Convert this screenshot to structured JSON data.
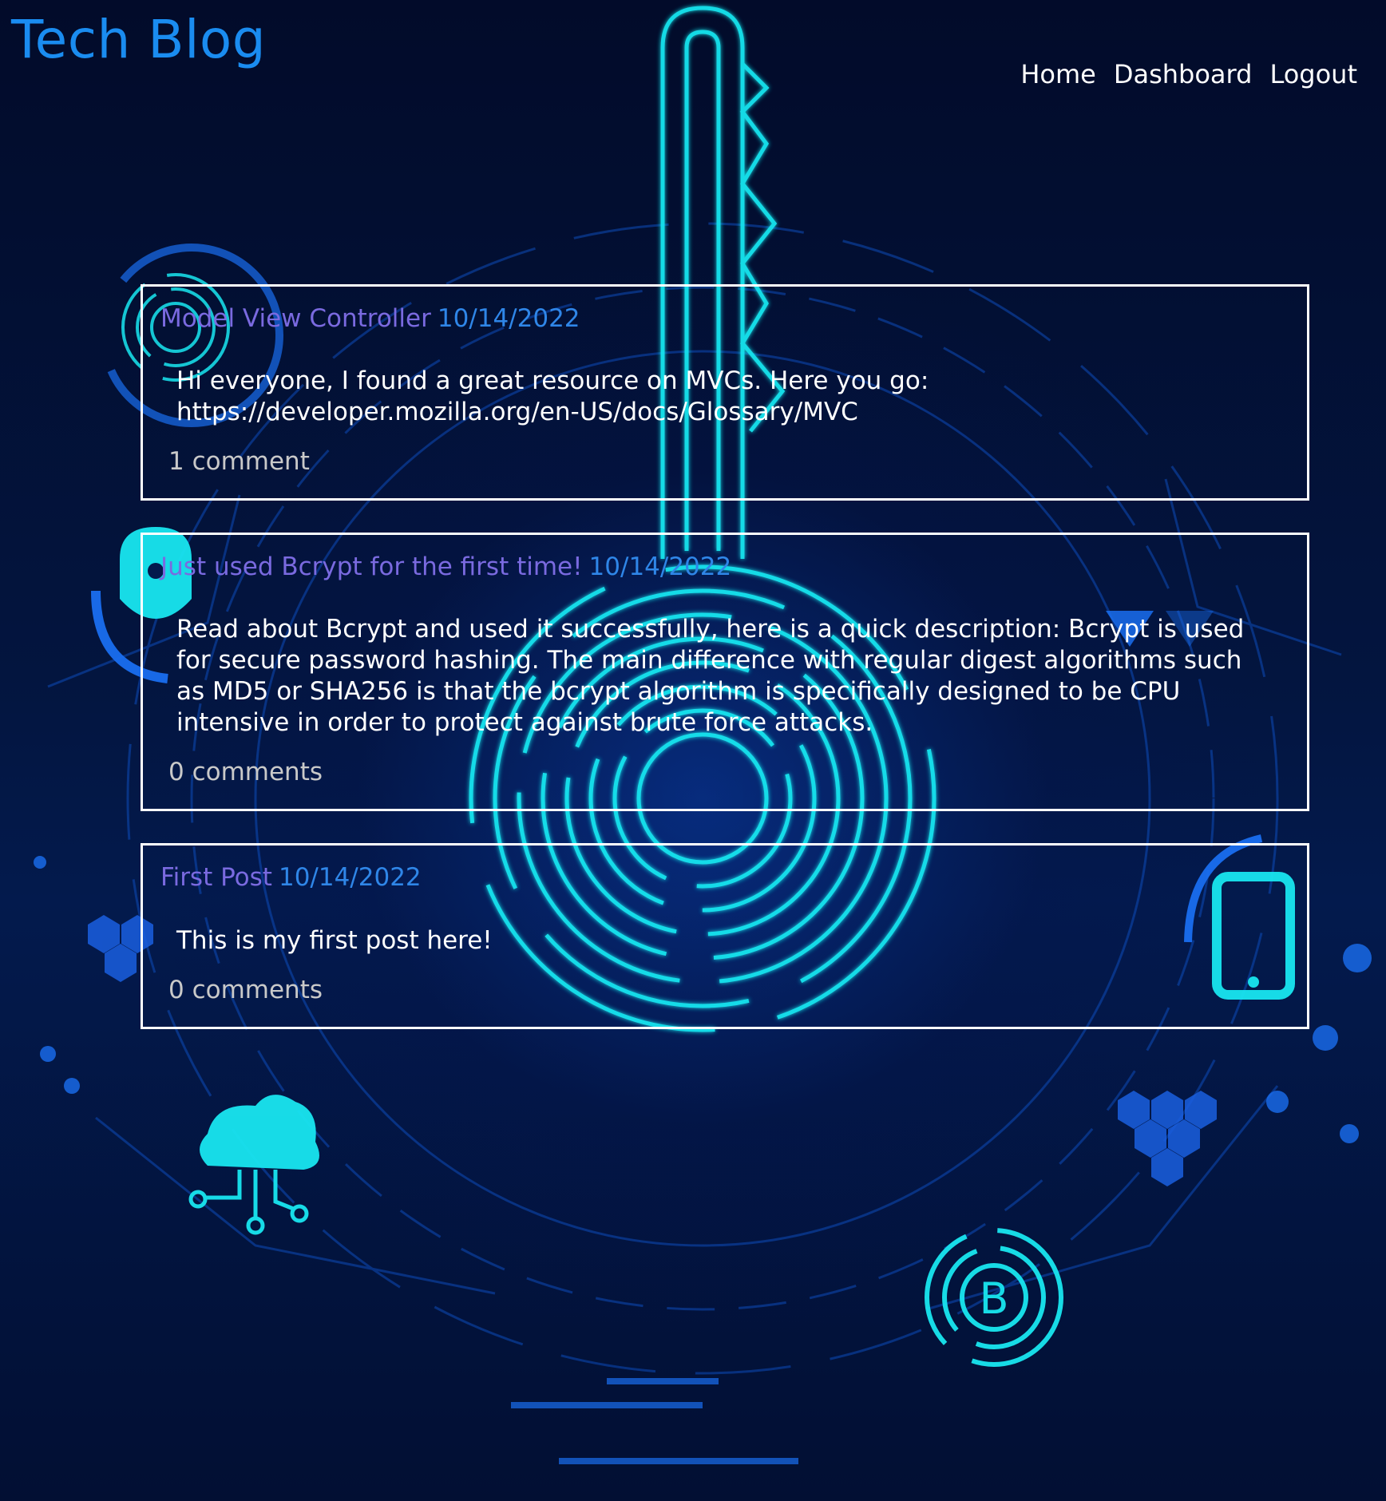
{
  "header": {
    "title": "Tech Blog",
    "nav": {
      "home": "Home",
      "dashboard": "Dashboard",
      "logout": "Logout"
    }
  },
  "posts": [
    {
      "title": "Model View Controller",
      "date": "10/14/2022",
      "body": "Hi everyone, I found a great resource on MVCs. Here you go: https://developer.mozilla.org/en-US/docs/Glossary/MVC",
      "comments": "1 comment"
    },
    {
      "title": "Just used Bcrypt for the first time!",
      "date": "10/14/2022",
      "body": "Read about Bcrypt and used it successfully, here is a quick description: Bcrypt is used for secure password hashing. The main difference with regular digest algorithms such as MD5 or SHA256 is that the bcrypt algorithm is specifically designed to be CPU intensive in order to protect against brute force attacks.",
      "comments": "0 comments"
    },
    {
      "title": "First Post",
      "date": "10/14/2022",
      "body": "This is my first post here!",
      "comments": "0 comments"
    }
  ],
  "colors": {
    "title": "#1a8cf0",
    "post_title": "#7a6ae0",
    "post_date": "#2f86e8",
    "background": "#020b2a",
    "accent_cyan": "#19e6f0"
  },
  "background_artwork": {
    "description_icons": [
      "key-circuit-icon",
      "fingerprint-icon",
      "lock-icon",
      "cloud-icon",
      "phone-icon",
      "bitcoin-icon",
      "hexagon-cluster-icon"
    ]
  }
}
